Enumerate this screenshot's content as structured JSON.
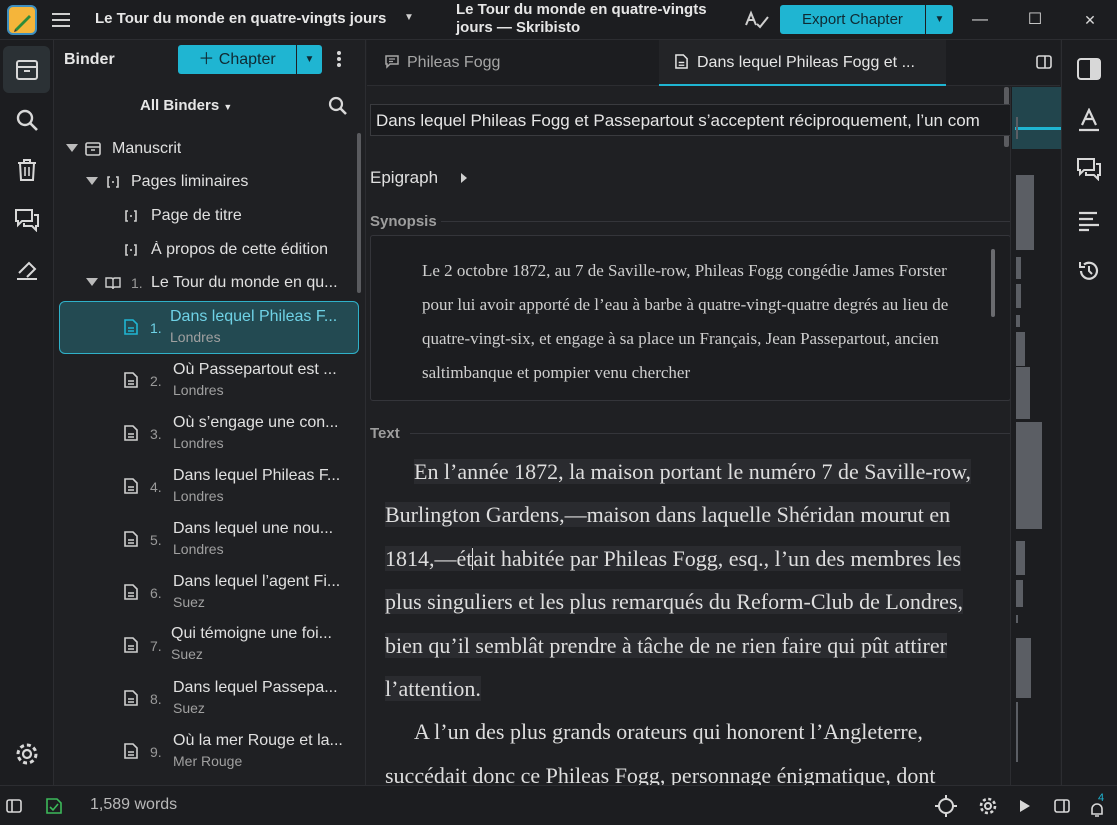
{
  "window": {
    "project_title": "Le Tour du monde en quatre-vingts jours",
    "title": "Le Tour du monde en quatre-vingts jours — Skribisto",
    "export_label": "Export Chapter",
    "controls": {
      "minimize": "—",
      "maximize": "☐",
      "close": "✕"
    }
  },
  "binder": {
    "heading": "Binder",
    "add_label": "Chapter",
    "filter_label": "All Binders",
    "items": [
      {
        "label": "Manuscrit",
        "icon": "archive-icon",
        "number": "",
        "sub": ""
      },
      {
        "label": "Pages liminaires",
        "icon": "section-icon",
        "number": "",
        "sub": ""
      },
      {
        "label": "Page de titre",
        "icon": "section-icon",
        "number": "",
        "sub": ""
      },
      {
        "label": "À propos de cette édition",
        "icon": "section-icon",
        "number": "",
        "sub": ""
      },
      {
        "label": "Le Tour du monde en qu...",
        "icon": "book-icon",
        "number": "1.",
        "sub": ""
      },
      {
        "label": "Dans lequel Phileas F...",
        "icon": "document-icon",
        "number": "1.",
        "sub": "Londres"
      },
      {
        "label": "Où Passepartout est ...",
        "icon": "document-icon",
        "number": "2.",
        "sub": "Londres"
      },
      {
        "label": "Où s’engage une con...",
        "icon": "document-icon",
        "number": "3.",
        "sub": "Londres"
      },
      {
        "label": "Dans lequel Phileas F...",
        "icon": "document-icon",
        "number": "4.",
        "sub": "Londres"
      },
      {
        "label": "Dans lequel une nou...",
        "icon": "document-icon",
        "number": "5.",
        "sub": "Londres"
      },
      {
        "label": "Dans lequel l’agent Fi...",
        "icon": "document-icon",
        "number": "6.",
        "sub": "Suez"
      },
      {
        "label": "Qui témoigne une foi...",
        "icon": "document-icon",
        "number": "7.",
        "sub": "Suez"
      },
      {
        "label": "Dans lequel Passepa...",
        "icon": "document-icon",
        "number": "8.",
        "sub": "Suez"
      },
      {
        "label": "Où la mer Rouge et la...",
        "icon": "document-icon",
        "number": "9.",
        "sub": "Mer Rouge"
      }
    ]
  },
  "tabs": [
    {
      "label": "Phileas Fogg",
      "icon": "comment-icon",
      "active": false
    },
    {
      "label": "Dans lequel Phileas Fogg et ...",
      "icon": "document-icon",
      "active": true
    }
  ],
  "editor": {
    "chapter_title": "Dans lequel Phileas Fogg et Passepartout s’acceptent réciproquement, l’un com",
    "epigraph_label": "Epigraph",
    "synopsis_label": "Synopsis",
    "synopsis_text": "Le 2 octobre 1872, au 7 de Saville-row, Phileas Fogg congédie James Forster pour lui avoir apporté de l’eau à barbe à quatre-vingt-quatre degrés au lieu de quatre-vingt-six, et engage à sa place un Français, Jean Passepartout, ancien saltimbanque et pompier venu chercher",
    "text_label": "Text",
    "paragraph1_before_caret": "En l’année 1872, la maison portant le numéro 7 de Saville-row, Burlington Gardens,—maison dans laquelle Shéridan mourut en 1814,—ét",
    "paragraph1_after_caret": "ait habitée par Phileas Fogg, esq., l’un des membres les plus singuliers et les plus remarqués du Reform-Club de Londres, bien qu’il semblât prendre à tâche de ne rien faire qui pût attirer l’attention.",
    "paragraph2": "A l’un des plus grands orateurs qui honorent l’Angleterre, succédait donc ce Phileas Fogg, personnage énigmatique, dont"
  },
  "status": {
    "word_count": "1,589 words",
    "notifications": "4"
  },
  "colors": {
    "accent": "#1fb5d2",
    "background": "#1f2023",
    "selected_row": "#234a52"
  }
}
